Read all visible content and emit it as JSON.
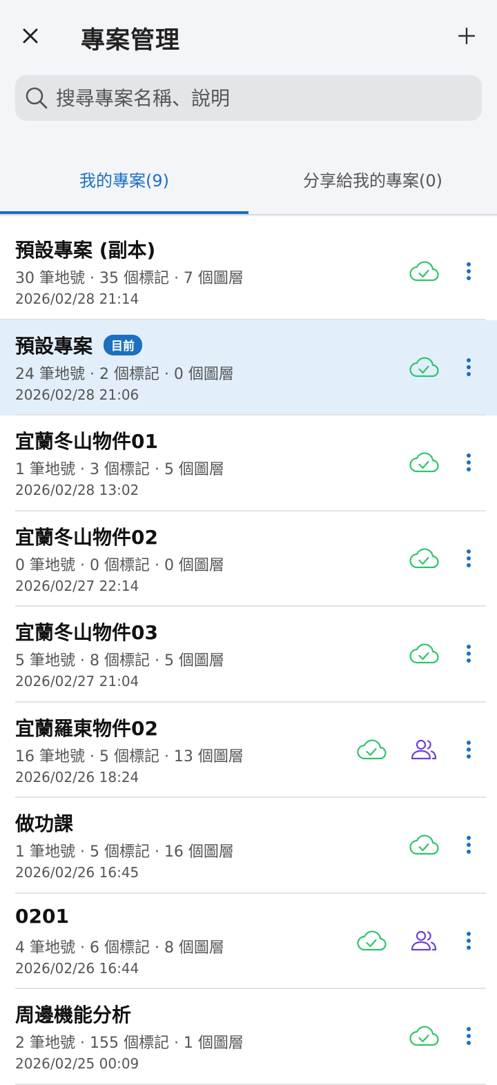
{
  "header": {
    "title": "專案管理",
    "close_icon": "close-icon",
    "add_icon": "plus-icon"
  },
  "search": {
    "placeholder": "搜尋專案名稱、說明"
  },
  "tabs": [
    {
      "label": "我的專案(9)",
      "active": true
    },
    {
      "label": "分享給我的專案(0)",
      "active": false
    }
  ],
  "colors": {
    "accent": "#1a6fc2",
    "synced_cloud": "#2ec46a",
    "shared_people": "#6b3fd8",
    "current_row_bg": "#e2effb"
  },
  "projects": [
    {
      "name": "預設專案 (副本)",
      "badge": "",
      "meta": "30 筆地號 · 35 個標記 · 7 個圖層",
      "updated": "2026/02/28 21:14",
      "synced": true,
      "shared": false
    },
    {
      "name": "預設專案",
      "badge": "目前",
      "meta": "24 筆地號 · 2 個標記 · 0 個圖層",
      "updated": "2026/02/28 21:06",
      "synced": true,
      "shared": false
    },
    {
      "name": "宜蘭冬山物件01",
      "badge": "",
      "meta": "1 筆地號 · 3 個標記 · 5 個圖層",
      "updated": "2026/02/28 13:02",
      "synced": true,
      "shared": false
    },
    {
      "name": "宜蘭冬山物件02",
      "badge": "",
      "meta": "0 筆地號 · 0 個標記 · 0 個圖層",
      "updated": "2026/02/27 22:14",
      "synced": true,
      "shared": false
    },
    {
      "name": "宜蘭冬山物件03",
      "badge": "",
      "meta": "5 筆地號 · 8 個標記 · 5 個圖層",
      "updated": "2026/02/27 21:04",
      "synced": true,
      "shared": false
    },
    {
      "name": "宜蘭羅東物件02",
      "badge": "",
      "meta": "16 筆地號 · 5 個標記 · 13 個圖層",
      "updated": "2026/02/26 18:24",
      "synced": true,
      "shared": true
    },
    {
      "name": "做功課",
      "badge": "",
      "meta": "1 筆地號 · 5 個標記 · 16 個圖層",
      "updated": "2026/02/26 16:45",
      "synced": true,
      "shared": false
    },
    {
      "name": "0201",
      "badge": "",
      "meta": "4 筆地號 · 6 個標記 · 8 個圖層",
      "updated": "2026/02/26 16:44",
      "synced": true,
      "shared": true
    },
    {
      "name": "周邊機能分析",
      "badge": "",
      "meta": "2 筆地號 · 155 個標記 · 1 個圖層",
      "updated": "2026/02/25 00:09",
      "synced": true,
      "shared": false
    }
  ]
}
